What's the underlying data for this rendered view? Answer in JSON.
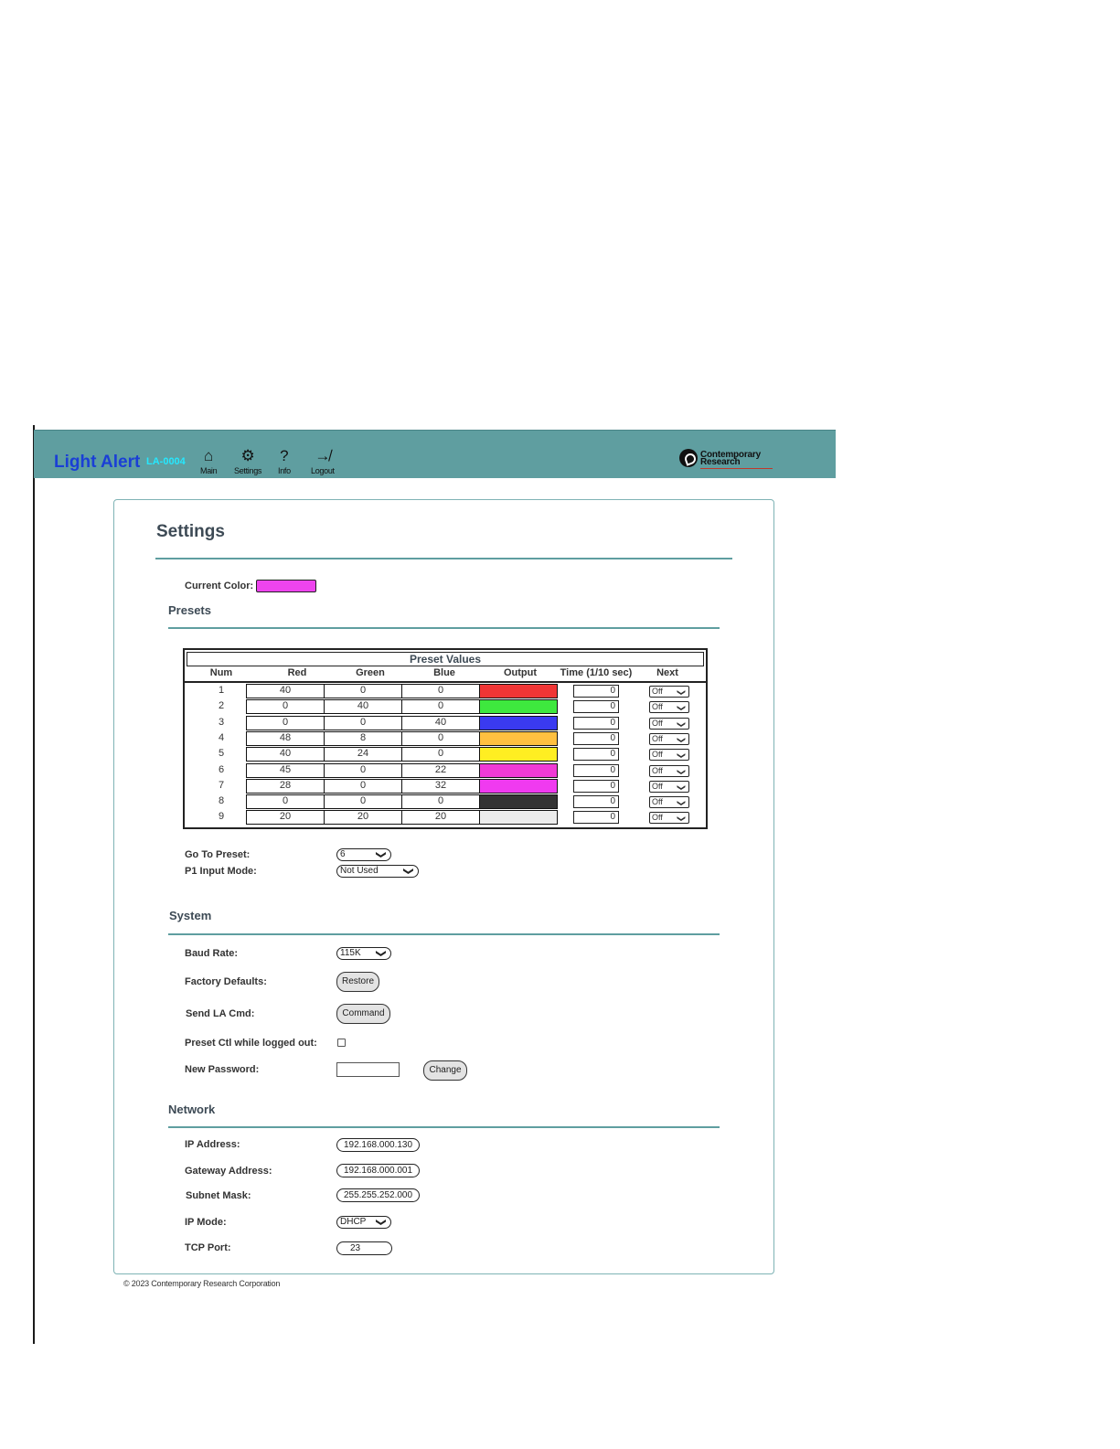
{
  "header": {
    "brand": "Light Alert",
    "device_id": "LA-0004",
    "nav": [
      {
        "label": "Main",
        "icon": "home-icon",
        "glyph": "⌂"
      },
      {
        "label": "Settings",
        "icon": "gear-icon",
        "glyph": "⚙"
      },
      {
        "label": "Info",
        "icon": "question-icon",
        "glyph": "?"
      },
      {
        "label": "Logout",
        "icon": "logout-icon",
        "glyph": "↛"
      }
    ],
    "logo_line1": "Contemporary",
    "logo_line2": "Research"
  },
  "page": {
    "title": "Settings",
    "current_color_label": "Current Color:",
    "current_color": "#ee44ee"
  },
  "presets": {
    "section_title": "Presets",
    "table_title": "Preset Values",
    "columns": [
      "Num",
      "Red",
      "Green",
      "Blue",
      "Output",
      "Time (1/10 sec)",
      "Next"
    ],
    "rows": [
      {
        "num": "1",
        "red": "40",
        "green": "0",
        "blue": "0",
        "color": "#f03535",
        "time": "0",
        "next": "Off"
      },
      {
        "num": "2",
        "red": "0",
        "green": "40",
        "blue": "0",
        "color": "#3ee83e",
        "time": "0",
        "next": "Off"
      },
      {
        "num": "3",
        "red": "0",
        "green": "0",
        "blue": "40",
        "color": "#3a3af0",
        "time": "0",
        "next": "Off"
      },
      {
        "num": "4",
        "red": "48",
        "green": "8",
        "blue": "0",
        "color": "#ffc040",
        "time": "0",
        "next": "Off"
      },
      {
        "num": "5",
        "red": "40",
        "green": "24",
        "blue": "0",
        "color": "#ffee22",
        "time": "0",
        "next": "Off"
      },
      {
        "num": "6",
        "red": "45",
        "green": "0",
        "blue": "22",
        "color": "#f03ad6",
        "time": "0",
        "next": "Off"
      },
      {
        "num": "7",
        "red": "28",
        "green": "0",
        "blue": "32",
        "color": "#f03af0",
        "time": "0",
        "next": "Off"
      },
      {
        "num": "8",
        "red": "0",
        "green": "0",
        "blue": "0",
        "color": "#333333",
        "time": "0",
        "next": "Off"
      },
      {
        "num": "9",
        "red": "20",
        "green": "20",
        "blue": "20",
        "color": "#ececec",
        "time": "0",
        "next": "Off"
      }
    ],
    "goto_label": "Go To Preset:",
    "goto_value": "6",
    "p1_label": "P1 Input Mode:",
    "p1_value": "Not Used"
  },
  "system": {
    "section_title": "System",
    "baud_label": "Baud Rate:",
    "baud_value": "115K",
    "factory_label": "Factory Defaults:",
    "restore_button": "Restore",
    "send_label": "Send LA Cmd:",
    "command_button": "Command",
    "preset_ctl_label": "Preset Ctl while logged out:",
    "password_label": "New Password:",
    "change_button": "Change"
  },
  "network": {
    "section_title": "Network",
    "ip_label": "IP Address:",
    "ip_value": "192.168.000.130",
    "gateway_label": "Gateway Address:",
    "gateway_value": "192.168.000.001",
    "subnet_label": "Subnet Mask:",
    "subnet_value": "255.255.252.000",
    "mode_label": "IP Mode:",
    "mode_value": "DHCP",
    "port_label": "TCP Port:",
    "port_value": "23"
  },
  "footer": "© 2023 Contemporary Research Corporation"
}
